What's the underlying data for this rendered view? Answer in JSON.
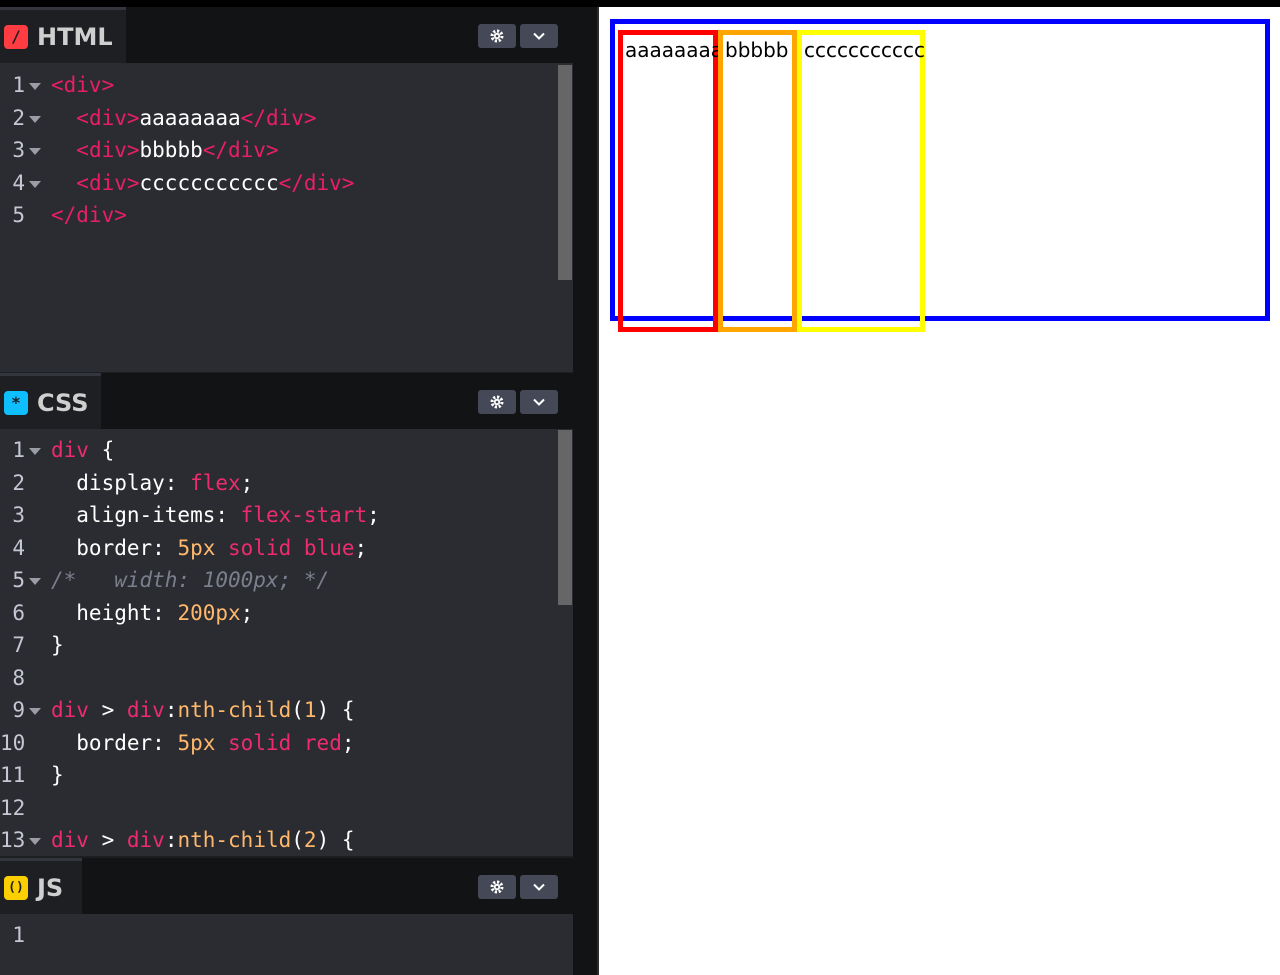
{
  "html_pane": {
    "tab_label": "HTML",
    "icon_glyph": "/",
    "icon_color": "#ff3c41",
    "lines": [
      {
        "n": "1",
        "fold": true,
        "text": "<div>"
      },
      {
        "n": "2",
        "fold": true,
        "text": "  <div>aaaaaaaa</div>"
      },
      {
        "n": "3",
        "fold": true,
        "text": "  <div>bbbbb</div>"
      },
      {
        "n": "4",
        "fold": true,
        "text": "  <div>ccccccccccc</div>"
      },
      {
        "n": "5",
        "fold": false,
        "text": "</div>"
      }
    ]
  },
  "css_pane": {
    "tab_label": "CSS",
    "icon_glyph": "*",
    "icon_color": "#0ebeff",
    "lines": [
      {
        "n": "1",
        "fold": true,
        "text": "div {"
      },
      {
        "n": "2",
        "fold": false,
        "text": "  display: flex;"
      },
      {
        "n": "3",
        "fold": false,
        "text": "  align-items: flex-start;"
      },
      {
        "n": "4",
        "fold": false,
        "text": "  border: 5px solid blue;"
      },
      {
        "n": "5",
        "fold": true,
        "text": "/*   width: 1000px; */"
      },
      {
        "n": "6",
        "fold": false,
        "text": "  height: 200px;"
      },
      {
        "n": "7",
        "fold": false,
        "text": "}"
      },
      {
        "n": "8",
        "fold": false,
        "text": ""
      },
      {
        "n": "9",
        "fold": true,
        "text": "div > div:nth-child(1) {"
      },
      {
        "n": "10",
        "fold": false,
        "text": "  border: 5px solid red;"
      },
      {
        "n": "11",
        "fold": false,
        "text": "}"
      },
      {
        "n": "12",
        "fold": false,
        "text": ""
      },
      {
        "n": "13",
        "fold": true,
        "text": "div > div:nth-child(2) {"
      }
    ]
  },
  "js_pane": {
    "tab_label": "JS",
    "icon_glyph": "()",
    "icon_color": "#fcd000",
    "lines": [
      {
        "n": "1",
        "fold": false,
        "text": ""
      }
    ]
  },
  "preview": {
    "outer_border_color": "#0000ff",
    "children": [
      {
        "text": "aaaaaaaa",
        "border_color": "#ff0000"
      },
      {
        "text": "bbbbb",
        "border_color": "#ffa500"
      },
      {
        "text": "ccccccccccc",
        "border_color": "#ffff00"
      }
    ]
  },
  "icons": {
    "settings": "gear-icon",
    "collapse": "chevron-down-icon"
  }
}
